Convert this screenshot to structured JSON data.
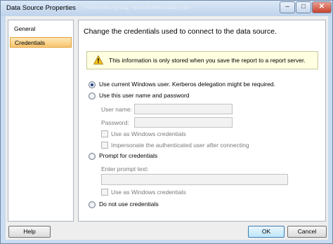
{
  "window": {
    "title": "Data Source Properties",
    "watermark": "Please visit my blog - www.SharePointDiary.com",
    "minimize": "–",
    "maximize": "□",
    "close": "✕"
  },
  "nav": {
    "items": [
      {
        "label": "General",
        "selected": false
      },
      {
        "label": "Credentials",
        "selected": true
      }
    ]
  },
  "panel": {
    "heading": "Change the credentials used to connect to the data source.",
    "info_icon": "warning-icon",
    "info_text": "This information is only stored when you save the report to a report server.",
    "options": {
      "windows_user": "Use current Windows user. Kerberos delegation might be required.",
      "user_password": "Use this user name and password",
      "prompt": "Prompt for credentials",
      "none": "Do not use credentials"
    },
    "selected_option": "windows_user",
    "user_name_label": "User name:",
    "user_name_value": "",
    "password_label": "Password:",
    "password_value": "",
    "use_windows_creds_1": "Use as Windows credentials",
    "impersonate": "Impersonate the authenticated user after connecting",
    "prompt_text_label": "Enter prompt text:",
    "prompt_text_value": "",
    "use_windows_creds_2": "Use as Windows credentials"
  },
  "buttons": {
    "help": "Help",
    "ok": "OK",
    "cancel": "Cancel"
  },
  "colors": {
    "selected_nav": "#f7c46e",
    "info_background": "#ffffe1",
    "warning_icon": "#f2c01e"
  }
}
